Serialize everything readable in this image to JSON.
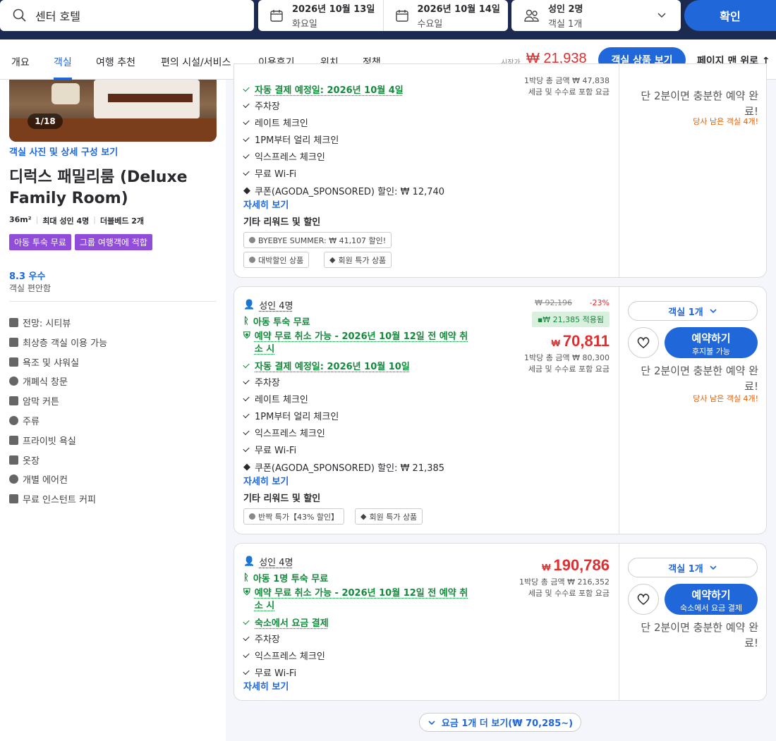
{
  "search": {
    "query": "센터 호텔"
  },
  "dates": {
    "checkin_date": "2026년 10월 13일",
    "checkin_day": "화요일",
    "checkout_date": "2026년 10월 14일",
    "checkout_day": "수요일"
  },
  "guests": {
    "line1": "성인 2명",
    "line2": "객실 1개"
  },
  "confirm_label": "확인",
  "nav": {
    "tabs": [
      "개요",
      "객실",
      "여행 추천",
      "편의 시설/서비스",
      "이용후기",
      "위치",
      "정책"
    ],
    "active_tab": "객실",
    "start_label": "시작가",
    "start_price": "₩ 21,938",
    "view_button": "객실 상품 보기",
    "to_top": "페이지 맨 위로"
  },
  "room": {
    "photo_count": "1/18",
    "photo_link": "객실 사진 및 상세 구성 보기",
    "title": "디럭스 패밀리룸 (Deluxe Family Room)",
    "specs": [
      "36m²",
      "최대 성인 4명",
      "더블베드 2개"
    ],
    "tags": [
      "아동 투숙 무료",
      "그룹 여행객에 적합"
    ],
    "score": "8.3 우수",
    "score_sub": "객실 편안함",
    "amenities": [
      "전망: 시티뷰",
      "최상층 객실 이용 가능",
      "욕조 및 샤워실",
      "개폐식 창문",
      "암막 커튼",
      "주류",
      "프라이빗 욕실",
      "옷장",
      "개별 에어컨",
      "무료 인스턴트 커피"
    ]
  },
  "offer1": {
    "auto_pay": "자동 결제 예정일: 2026년 10월 4일",
    "features": [
      "주차장",
      "레이트 체크인",
      "1PM부터 얼리 체크인",
      "익스프레스 체크인",
      "무료 Wi-Fi"
    ],
    "coupon": "쿠폰(AGODA_SPONSORED) 할인: ₩ 12,740",
    "details": "자세히 보기",
    "promo_header": "기타 리워드 및 할인",
    "chips": [
      "BYEBYE SUMMER: ₩ 41,107 할인!",
      "대박할인 상품",
      "회원 특가 상품"
    ],
    "per_night_total": "1박당 총 금액 ₩ 47,838",
    "tax_note": "세금 및 수수료 포함 요금",
    "availability": "단 2분이면 충분한 예약 완료!",
    "rooms_left": "당사 남은 객실 4개!"
  },
  "offer2": {
    "occupancy": "성인 4명",
    "child": "아동 투숙 무료",
    "free_cancel": "예약 무료 취소 가능 - 2026년 10월 12일 전 예약 취소 시",
    "auto_pay": "자동 결제 예정일: 2026년 10월 10일",
    "features": [
      "주차장",
      "레이트 체크인",
      "1PM부터 얼리 체크인",
      "익스프레스 체크인",
      "무료 Wi-Fi"
    ],
    "coupon": "쿠폰(AGODA_SPONSORED) 할인: ₩ 21,385",
    "details": "자세히 보기",
    "promo_header": "기타 리워드 및 할인",
    "chips": [
      "반짝 특가【43% 할인】",
      "회원 특가 상품"
    ],
    "original_price": "₩ 92,196",
    "discount": "-23%",
    "applied": "₩ 21,385 적용됨",
    "currency": "₩",
    "price": "70,811",
    "per_night_total": "1박당 총 금액 ₩ 80,300",
    "tax_note": "세금 및 수수료 포함 요금",
    "room_select": "객실 1개",
    "book_label": "예약하기",
    "book_sub": "후지불 가능",
    "availability": "단 2분이면 충분한 예약 완료!",
    "rooms_left": "당사 남은 객실 4개!"
  },
  "offer3": {
    "occupancy": "성인 4명",
    "child": "아동 1명 투숙 무료",
    "free_cancel": "예약 무료 취소 가능 - 2026년 10월 12일 전 예약 취소 시",
    "pay_at_hotel": "숙소에서 요금 결제",
    "features": [
      "주차장",
      "익스프레스 체크인",
      "무료 Wi-Fi"
    ],
    "details": "자세히 보기",
    "currency": "₩",
    "price": "190,786",
    "per_night_total": "1박당 총 금액 ₩ 216,352",
    "tax_note": "세금 및 수수료 포함 요금",
    "room_select": "객실 1개",
    "book_label": "예약하기",
    "book_sub": "숙소에서 요금 결제",
    "availability": "단 2분이면 충분한 예약 완료!"
  },
  "more_rates": "요금 1개 더 보기(₩ 70,285~)",
  "colors": {
    "brand_blue": "#2067da",
    "price_red": "#e12d2d",
    "green": "#148a3c",
    "header": "#1c2a50",
    "tag_purple": "#8f4dd8"
  }
}
